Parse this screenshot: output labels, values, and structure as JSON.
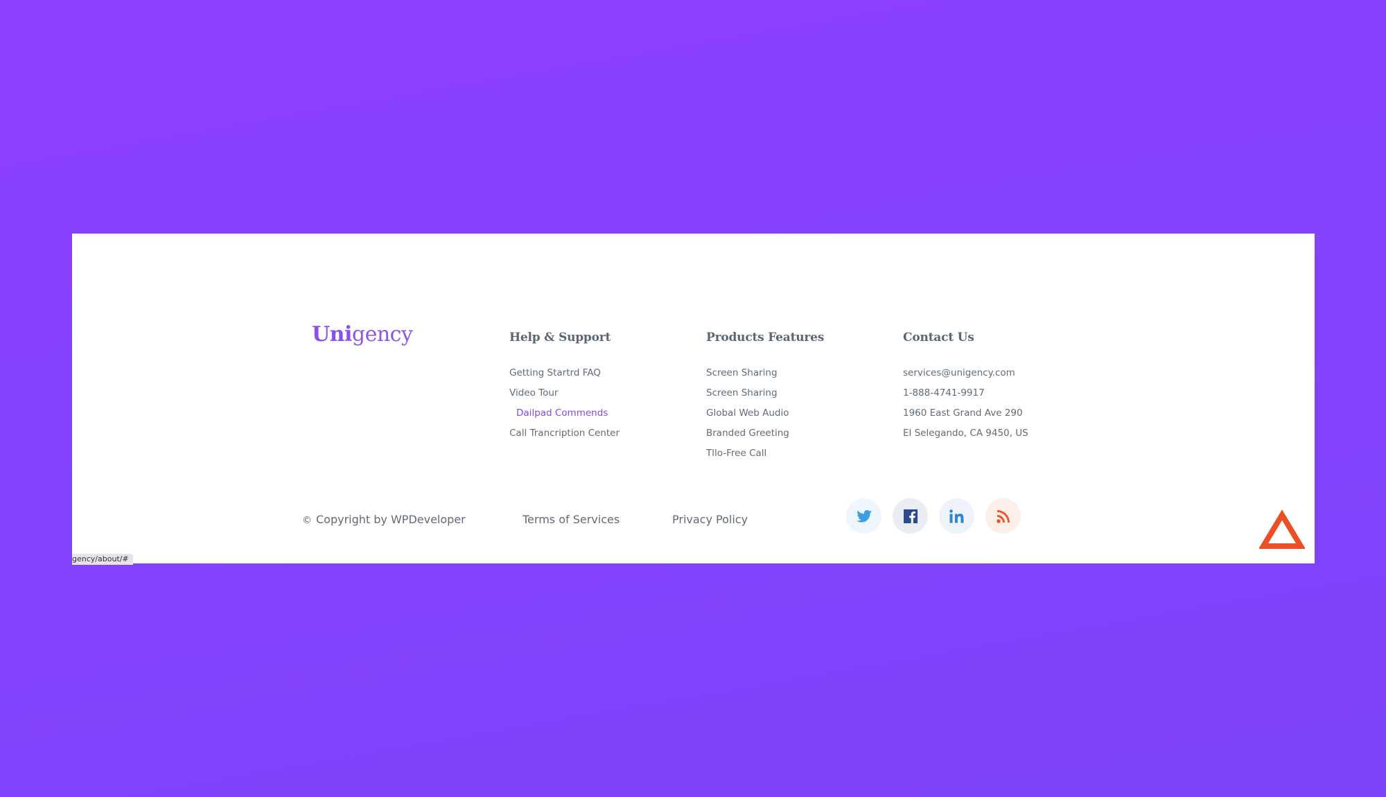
{
  "brand": {
    "logo_bold": "Uni",
    "logo_rest": "gency"
  },
  "columns": [
    {
      "title": "Help & Support",
      "items": [
        "Getting Startrd FAQ",
        "Video Tour",
        "Dailpad Commends",
        "Call Trancription Center"
      ],
      "active_index": 2
    },
    {
      "title": "Products Features",
      "items": [
        "Screen Sharing",
        "Screen Sharing",
        "Global Web Audio",
        "Branded Greeting",
        "Tllo-Free Call"
      ]
    },
    {
      "title": "Contact Us",
      "items": [
        "services@unigency.com",
        "1-888-4741-9917",
        "1960 East Grand Ave 290",
        "El Selegando, CA 9450, US"
      ]
    }
  ],
  "bottom": {
    "copyright_symbol": "©",
    "copyright": "Copyright by WPDeveloper",
    "terms": "Terms of Services",
    "privacy": "Privacy Policy"
  },
  "socials": [
    {
      "name": "twitter-icon",
      "color": "#3b9fe0"
    },
    {
      "name": "facebook-icon",
      "color": "#2d4a8c"
    },
    {
      "name": "linkedin-icon",
      "color": "#2f86c9"
    },
    {
      "name": "rss-icon",
      "color": "#e8582a"
    }
  ],
  "scroll_top": {
    "icon": "triangle-up-icon",
    "color": "#ea5026"
  },
  "status_bar": {
    "url": "gency/about/#"
  },
  "colors": {
    "accent": "#8a48e0",
    "background": "#8441fd"
  }
}
